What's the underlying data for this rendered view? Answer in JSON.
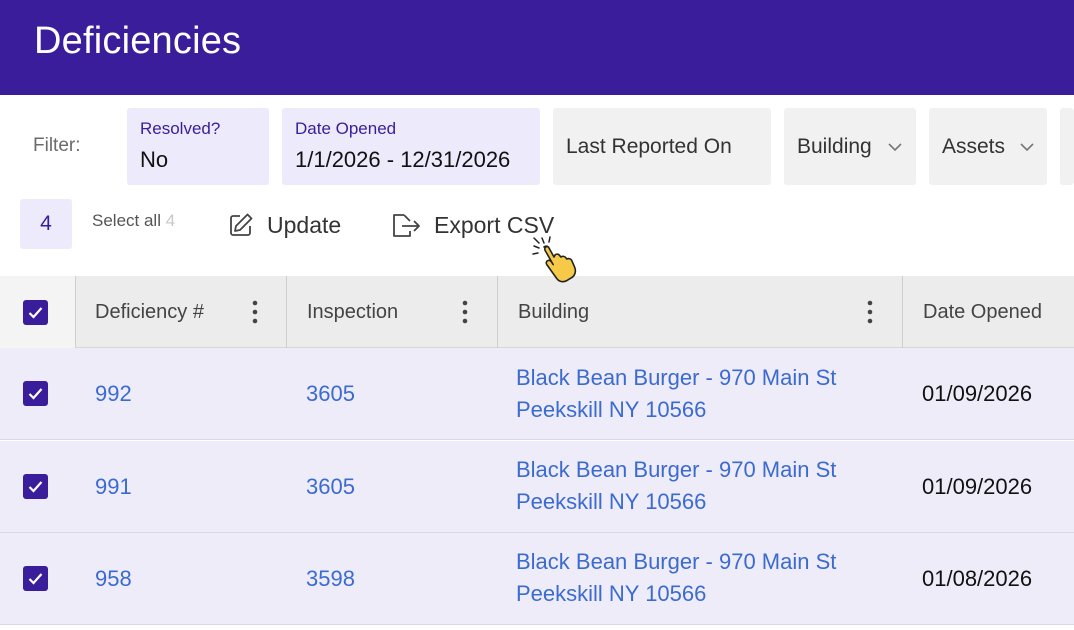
{
  "page": {
    "title": "Deficiencies"
  },
  "colors": {
    "brand": "#3a1d9a",
    "link": "#3b6bd1",
    "row_selected": "#eeecf8"
  },
  "filters": {
    "label": "Filter:",
    "resolved": {
      "label": "Resolved?",
      "value": "No"
    },
    "date_opened": {
      "label": "Date Opened",
      "value": "1/1/2026 - 12/31/2026"
    },
    "last_reported": {
      "label": "Last Reported On"
    },
    "building": {
      "label": "Building"
    },
    "assets": {
      "label": "Assets"
    }
  },
  "toolbar": {
    "selected_count": "4",
    "select_all_label": "Select all",
    "select_all_count": "4",
    "update_label": "Update",
    "export_label": "Export CSV"
  },
  "table": {
    "columns": [
      "Deficiency #",
      "Inspection",
      "Building",
      "Date Opened"
    ],
    "rows": [
      {
        "deficiency": "992",
        "inspection": "3605",
        "building_line1": "Black Bean Burger - 970 Main St",
        "building_line2": "Peekskill NY 10566",
        "date_opened": "01/09/2026"
      },
      {
        "deficiency": "991",
        "inspection": "3605",
        "building_line1": "Black Bean Burger - 970 Main St",
        "building_line2": "Peekskill NY 10566",
        "date_opened": "01/09/2026"
      },
      {
        "deficiency": "958",
        "inspection": "3598",
        "building_line1": "Black Bean Burger - 970 Main St",
        "building_line2": "Peekskill NY 10566",
        "date_opened": "01/08/2026"
      }
    ]
  },
  "icons": [
    "pencil-square-icon",
    "export-arrow-icon",
    "chevron-down-icon",
    "kebab-menu-icon",
    "checkmark-icon",
    "pointer-hand-icon"
  ]
}
